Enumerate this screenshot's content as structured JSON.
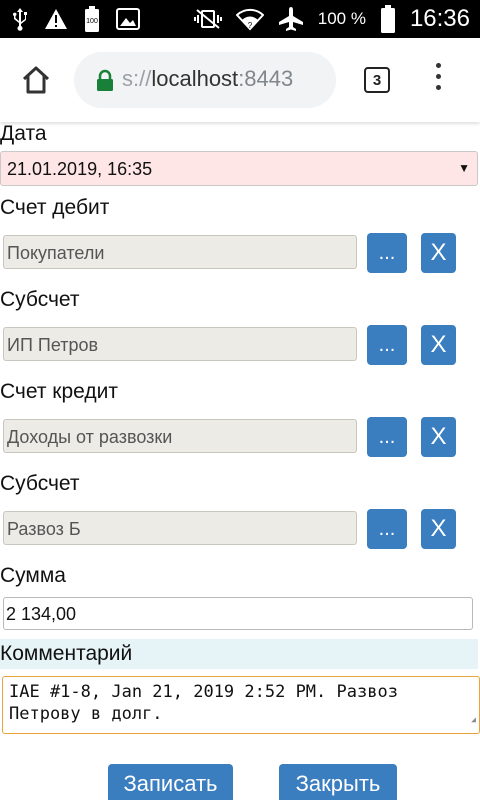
{
  "status_bar": {
    "battery_text": "100 %",
    "time": "16:36",
    "icons": [
      "usb-icon",
      "warning-icon",
      "battery-full-small-icon",
      "image-icon",
      "vibrate-off-icon",
      "wifi-icon",
      "airplane-icon",
      "battery-icon"
    ]
  },
  "browser": {
    "url_prefix": "s://",
    "url_host": "localhost",
    "url_port": ":8443",
    "tab_count": "3",
    "icons": [
      "home-icon",
      "lock-icon",
      "tabs-icon",
      "more-vert-icon"
    ]
  },
  "form": {
    "date": {
      "label": "Дата",
      "value": "21.01.2019, 16:35",
      "bg_color": "#ffe6e6"
    },
    "debit_account": {
      "label": "Счет дебит",
      "value": "Покупатели"
    },
    "debit_subaccount": {
      "label": "Субсчет",
      "value": "ИП Петров"
    },
    "credit_account": {
      "label": "Счет кредит",
      "value": "Доходы от развозки"
    },
    "credit_subaccount": {
      "label": "Субсчет",
      "value": "Развоз Б"
    },
    "amount": {
      "label": "Сумма",
      "value": "2 134,00"
    },
    "comment": {
      "label": "Комментарий",
      "line1": "IAE #1-8, Jan 21, 2019 2:52 PM. Развоз",
      "line2": "Петрову в долг."
    },
    "pick_label": "...",
    "clear_label": "X"
  },
  "actions": {
    "save_label": "Записать",
    "close_label": "Закрыть"
  },
  "colors": {
    "button": "#3a7ec0",
    "readonly_bg": "#ecebe6",
    "comment_border": "#e8a33a",
    "comment_band": "#e7f4f7"
  }
}
